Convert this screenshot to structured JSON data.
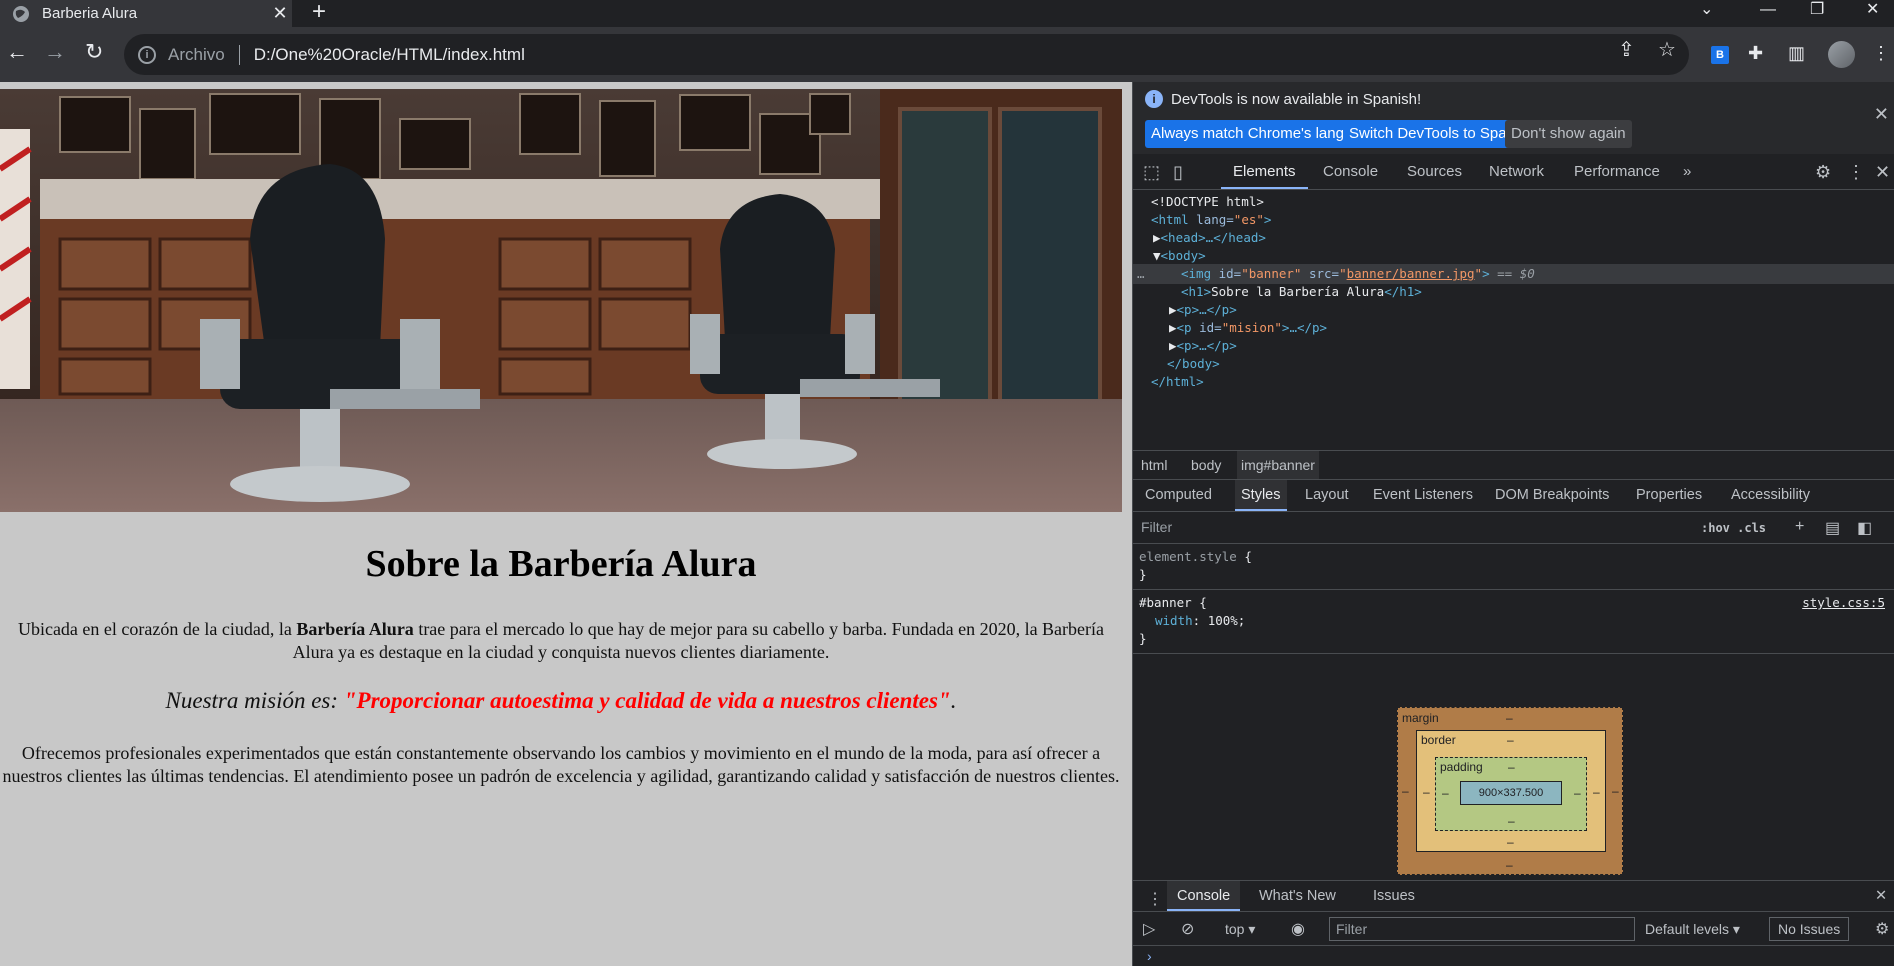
{
  "browser": {
    "tab_title": "Barberia Alura",
    "tab_close": "✕",
    "new_tab": "+",
    "address_scheme": "Archivo",
    "address_url": "D:/One%20Oracle/HTML/index.html",
    "ext_badge": "B"
  },
  "page": {
    "heading": "Sobre la Barbería Alura",
    "p1_before": "Ubicada en el corazón de la ciudad, la ",
    "p1_bold": "Barbería Alura",
    "p1_after": " trae para el mercado lo que hay de mejor para su cabello y barba. Fundada en 2020, la Barbería Alura ya es destaque en la ciudad y conquista nuevos clientes diariamente.",
    "mision_label": "Nuestra misión es: ",
    "mision_quote": "\"Proporcionar autoestima y calidad de vida a nuestros clientes\"",
    "mision_end": ".",
    "p3": "Ofrecemos profesionales experimentados que están constantemente observando los cambios y movimiento en el mundo de la moda, para así ofrecer a nuestros clientes las últimas tendencias. El atendimiento posee un padrón de excelencia y agilidad, garantizando calidad y satisfacción de nuestros clientes."
  },
  "devtools": {
    "info_message": "DevTools is now available in Spanish!",
    "btn_match": "Always match Chrome's language",
    "btn_switch": "Switch DevTools to Spanish",
    "btn_dont": "Don't show again",
    "tabs": [
      "Elements",
      "Console",
      "Sources",
      "Network",
      "Performance"
    ],
    "more_tabs": "»",
    "dom": {
      "doctype": "<!DOCTYPE html>",
      "html_open": "<html",
      "html_attr": " lang=",
      "html_attr_val": "\"es\"",
      "gt": ">",
      "head": "<head>…</head>",
      "body_open": "<body>",
      "img_open": "<img",
      "img_id_attr": " id=",
      "img_id_val": "\"banner\"",
      "img_src_attr": " src=",
      "img_src_quote_open": "\"",
      "img_src_val": "banner/banner.jpg",
      "img_src_quote_close": "\"",
      "img_end": ">",
      "dollar0": " == $0",
      "dots": "…",
      "h1_open": "<h1>",
      "h1_text": "Sobre la Barbería Alura",
      "h1_close": "</h1>",
      "p_collapsed": "<p>…</p>",
      "p_mision_open": "<p",
      "p_mision_id_attr": " id=",
      "p_mision_id_val": "\"mision\"",
      "p_mision_rest": ">…</p>",
      "body_close": "</body>",
      "html_close": "</html>"
    },
    "crumbs": [
      "html",
      "body",
      "img#banner"
    ],
    "subtabs": [
      "Computed",
      "Styles",
      "Layout",
      "Event Listeners",
      "DOM Breakpoints",
      "Properties",
      "Accessibility"
    ],
    "filter_placeholder": "Filter",
    "hov_cls": ":hov  .cls",
    "element_style_sel": "element.style",
    "open_brace": " {",
    "close_brace": "}",
    "banner_rule_sel": "#banner",
    "banner_prop": "width",
    "banner_val": ": 100%;",
    "banner_src": "style.css:5",
    "boxmodel": {
      "margin_label": "margin",
      "border_label": "border",
      "padding_label": "padding",
      "content_size": "900×337.500",
      "dash": "–"
    },
    "drawer_tabs": [
      "Console",
      "What's New",
      "Issues"
    ],
    "console_context": "top",
    "console_filter": "Filter",
    "default_levels": "Default levels",
    "no_issues": "No Issues",
    "prompt": "›"
  },
  "colors": {
    "mision_red": "#ff0000",
    "accent": "#1a73e8",
    "page_bg": "#c8c8c8"
  }
}
